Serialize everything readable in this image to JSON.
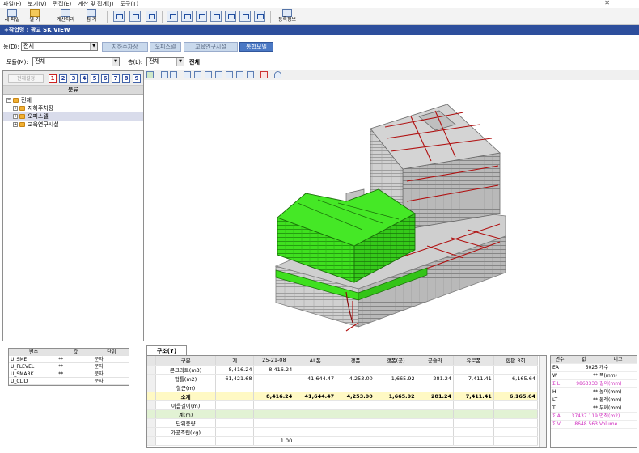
{
  "menu": [
    "파일(F)",
    "보기(V)",
    "편집(E)",
    "계산 및 집계(J)",
    "도구(T)"
  ],
  "toolbar": {
    "new_label": "새 파일",
    "open_label": "열 기",
    "calc_label": "계산처리",
    "total_label": "집 계",
    "register_label": "등록정보"
  },
  "work_title": "+작업명 : 광교 SK VIEW",
  "model_row": {
    "dong_label": "동(D):",
    "dong_value": "전체",
    "tabs": [
      "지하주차장",
      "오피스텔",
      "교육연구시설",
      "통합모델"
    ],
    "active_tab": "통합모델"
  },
  "filter_row": {
    "module_label": "모듈(M):",
    "module_value": "전체",
    "floor_label": "층(L):",
    "floor_value": "전체",
    "floor_display": "전체"
  },
  "tree": {
    "reset_label": "전체설정",
    "numbers": [
      "1",
      "2",
      "3",
      "4",
      "5",
      "6",
      "7",
      "8",
      "9"
    ],
    "header": "분류",
    "items": [
      {
        "label": "전체",
        "level": 0,
        "selected": false
      },
      {
        "label": "지하주차장",
        "level": 1,
        "selected": false
      },
      {
        "label": "오피스텔",
        "level": 1,
        "selected": true
      },
      {
        "label": "교육연구시설",
        "level": 1,
        "selected": false
      }
    ]
  },
  "prop_grid": {
    "headers": [
      "변수",
      "값",
      "단위"
    ],
    "rows": [
      [
        "U_SME",
        "**",
        "문자"
      ],
      [
        "U_FLEVEL",
        "**",
        "문자"
      ],
      [
        "U_SMARK",
        "**",
        "문자"
      ],
      [
        "U_CLID",
        "",
        "문자"
      ]
    ]
  },
  "quantity": {
    "tab_label": "구조(Y)",
    "headers": [
      "구분",
      "계",
      "25-21-08",
      "AL폼",
      "갱폼",
      "갱폼(공)",
      "공슬라",
      "유로폼",
      "합판 3회"
    ],
    "rows": [
      {
        "label": "콘크리트(m3)",
        "cells": [
          "8,416.24",
          "8,416.24",
          "",
          "",
          "",
          "",
          "",
          ""
        ],
        "style": ""
      },
      {
        "label": "형틀(m2)",
        "cells": [
          "61,421.68",
          "",
          "41,644.47",
          "4,253.00",
          "1,665.92",
          "281.24",
          "7,411.41",
          "6,165.64"
        ],
        "style": ""
      },
      {
        "label": "철근(m)",
        "cells": [
          "",
          "",
          "",
          "",
          "",
          "",
          "",
          ""
        ],
        "style": ""
      },
      {
        "label": "소계",
        "cells": [
          "",
          "8,416.24",
          "41,644.47",
          "4,253.00",
          "1,665.92",
          "281.24",
          "7,411.41",
          "6,165.64"
        ],
        "style": "subtotal"
      },
      {
        "label": "이음길이(m)",
        "cells": [
          "",
          "",
          "",
          "",
          "",
          "",
          "",
          ""
        ],
        "style": ""
      },
      {
        "label": "계(m)",
        "cells": [
          "",
          "",
          "",
          "",
          "",
          "",
          "",
          ""
        ],
        "style": "green"
      },
      {
        "label": "단위중량",
        "cells": [
          "",
          "",
          "",
          "",
          "",
          "",
          "",
          ""
        ],
        "style": ""
      },
      {
        "label": "가공조립(kg)",
        "cells": [
          "",
          "",
          "",
          "",
          "",
          "",
          "",
          ""
        ],
        "style": ""
      },
      {
        "label": "",
        "cells": [
          "",
          "1.00",
          "",
          "",
          "",
          "",
          "",
          ""
        ],
        "style": ""
      }
    ]
  },
  "var_panel": {
    "headers": [
      "변수",
      "값",
      "비고"
    ],
    "rows": [
      {
        "name": "EA",
        "value": "5025",
        "note": "개수",
        "pink": false
      },
      {
        "name": "W",
        "value": "**",
        "note": "폭(mm)",
        "pink": false
      },
      {
        "name": "Σ L",
        "value": "9863333",
        "note": "길이(mm)",
        "pink": true
      },
      {
        "name": "H",
        "value": "**",
        "note": "높이(mm)",
        "pink": false
      },
      {
        "name": "LT",
        "value": "**",
        "note": "둘레(mm)",
        "pink": false
      },
      {
        "name": "T",
        "value": "**",
        "note": "두께(mm)",
        "pink": false
      },
      {
        "name": "Σ A",
        "value": "37437.119",
        "note": "면적(m2)",
        "pink": true
      },
      {
        "name": "Σ V",
        "value": "8648.563",
        "note": "Volume",
        "pink": true
      }
    ]
  },
  "colors": {
    "accent": "#2d4e9c",
    "highlight_green": "#3fe01f",
    "building_grey": "#c9c9c9",
    "red_lines": "#b01010",
    "subtotal_bg": "#fff9c4"
  }
}
